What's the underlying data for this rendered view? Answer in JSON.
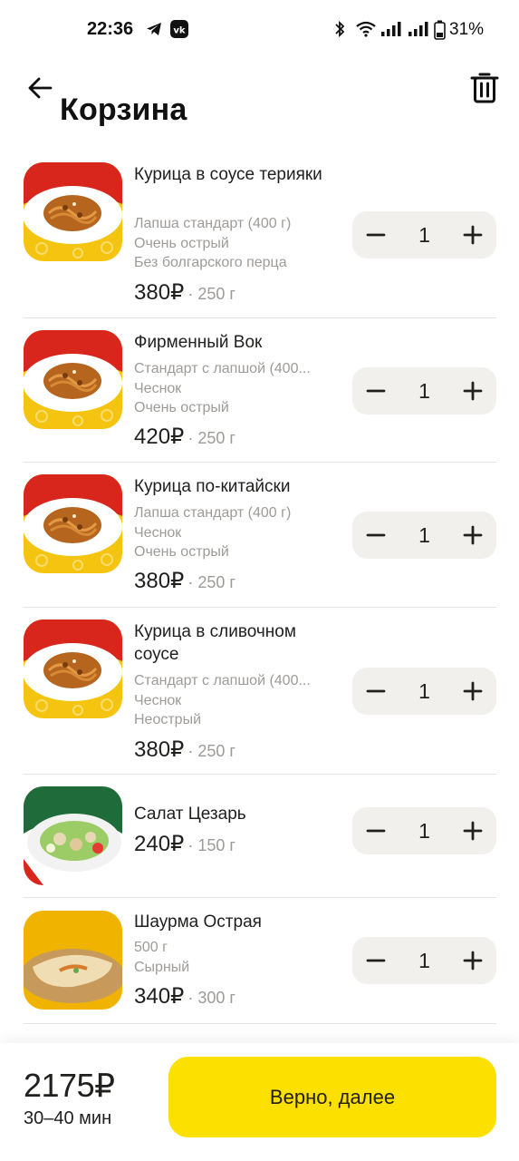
{
  "status_bar": {
    "time": "22:36",
    "battery_percent": "31%",
    "icons": [
      "telegram-icon",
      "vk-icon",
      "bluetooth-icon",
      "wifi-icon",
      "signal-icon",
      "signal-icon",
      "battery-icon"
    ]
  },
  "header": {
    "title": "Корзина",
    "back_icon": "arrow-left-icon",
    "trash_icon": "trash-icon"
  },
  "items": [
    {
      "name": "Курица в соусе терияки",
      "options": [
        "Лапша стандарт (400 г)",
        "Очень острый",
        "Без болгарского перца"
      ],
      "price": "380",
      "currency": "₽",
      "weight": "· 250 г",
      "quantity": "1",
      "image": "noodles-dish-red"
    },
    {
      "name": "Фирменный Вок",
      "options": [
        "Стандарт с лапшой (400...",
        "Чеснок",
        "Очень острый"
      ],
      "price": "420",
      "currency": "₽",
      "weight": "· 250 г",
      "quantity": "1",
      "image": "noodles-dish-red"
    },
    {
      "name": "Курица по-китайски",
      "options": [
        "Лапша стандарт (400 г)",
        "Чеснок",
        "Очень острый"
      ],
      "price": "380",
      "currency": "₽",
      "weight": "· 250 г",
      "quantity": "1",
      "image": "noodles-dish-red"
    },
    {
      "name": "Курица в сливочном соусе",
      "options": [
        "Стандарт с лапшой (400...",
        "Чеснок",
        "Неострый"
      ],
      "price": "380",
      "currency": "₽",
      "weight": "· 250 г",
      "quantity": "1",
      "image": "noodles-dish-red"
    },
    {
      "name": "Салат Цезарь",
      "options": [],
      "price": "240",
      "currency": "₽",
      "weight": "· 150 г",
      "quantity": "1",
      "image": "salad-green"
    },
    {
      "name": "Шаурма Острая",
      "options": [
        "500 г",
        "Сырный"
      ],
      "price": "340",
      "currency": "₽",
      "weight": "· 300 г",
      "quantity": "1",
      "image": "shawarma-yellow"
    }
  ],
  "footer": {
    "total": "2175₽",
    "delivery_time": "30–40 мин",
    "next_label": "Верно, далее"
  },
  "colors": {
    "accent": "#fce000",
    "text": "#21201f",
    "secondary_text": "#9e9b98",
    "stepper_bg": "#f2f0ec"
  }
}
